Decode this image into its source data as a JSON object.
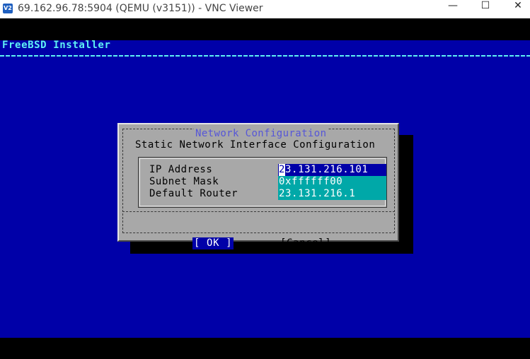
{
  "window": {
    "icon_text": "V2",
    "title": "69.162.96.78:5904 (QEMU (v3151)) - VNC Viewer",
    "minimize_glyph": "—",
    "maximize_glyph": "☐",
    "close_glyph": "✕"
  },
  "installer": {
    "title": "FreeBSD Installer"
  },
  "dialog": {
    "title": "Network Configuration",
    "subtitle": "Static Network Interface Configuration",
    "fields": [
      {
        "label": "IP Address",
        "value_cursor": "2",
        "value_rest": "3.131.216.101"
      },
      {
        "label": "Subnet Mask",
        "value": "0xffffff00"
      },
      {
        "label": "Default Router",
        "value": "23.131.216.1"
      }
    ],
    "ok_label": "[  OK  ]",
    "cancel_label": "[Cancel]"
  },
  "colors": {
    "background": "#0000a8",
    "dialog": "#a8a8a8",
    "field_active": "#0000a8",
    "field_inactive": "#00a8a8",
    "title_text": "#5ef0f4"
  },
  "icons": [
    "vnc-app-icon",
    "minimize-icon",
    "maximize-icon",
    "close-icon"
  ]
}
